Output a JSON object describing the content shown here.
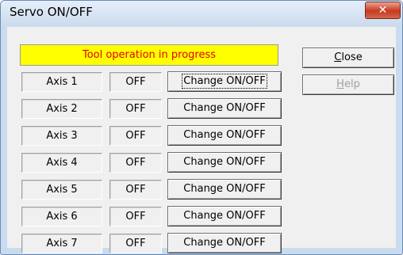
{
  "window": {
    "title": "Servo ON/OFF",
    "close_glyph": "✕"
  },
  "status_message": "Tool operation in progress",
  "buttons": {
    "close": {
      "label_mnemonic": "C",
      "label_rest": "lose"
    },
    "help": {
      "label_mnemonic": "H",
      "label_rest": "elp"
    }
  },
  "axes": [
    {
      "label": "Axis 1",
      "state": "OFF",
      "button": "Change ON/OFF"
    },
    {
      "label": "Axis 2",
      "state": "OFF",
      "button": "Change ON/OFF"
    },
    {
      "label": "Axis 3",
      "state": "OFF",
      "button": "Change ON/OFF"
    },
    {
      "label": "Axis 4",
      "state": "OFF",
      "button": "Change ON/OFF"
    },
    {
      "label": "Axis 5",
      "state": "OFF",
      "button": "Change ON/OFF"
    },
    {
      "label": "Axis 6",
      "state": "OFF",
      "button": "Change ON/OFF"
    },
    {
      "label": "Axis 7",
      "state": "OFF",
      "button": "Change ON/OFF"
    }
  ],
  "colors": {
    "status_bg": "#ffff00",
    "status_text": "#e00000",
    "close_button": "#c8432b"
  }
}
